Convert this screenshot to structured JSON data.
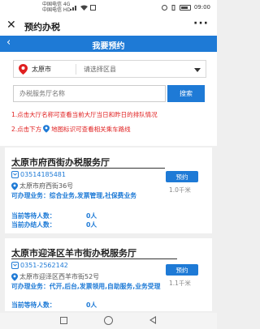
{
  "status_bar": {
    "carrier_1": "中国电信 4G",
    "carrier_2": "中国电信 HD",
    "time": "09:00"
  },
  "app_bar": {
    "close_icon": "close-icon",
    "title": "预约办税",
    "more_icon": "more-icon"
  },
  "header": {
    "back_icon": "back-icon",
    "title": "我要预约"
  },
  "filter": {
    "city": "太原市",
    "district_placeholder": "请选择区县",
    "search_placeholder": "办税服务厅名称",
    "search_button": "搜索",
    "tip1": "1.点击大厅名称可查看当前大厅当日和昨日的排队情况",
    "tip2_prefix": "2.点击下方",
    "tip2_suffix": "地图标识可查看相关乘车路线"
  },
  "halls": [
    {
      "name": "太原市府西街办税服务厅",
      "phone": "03514185481",
      "address": "太原市府西街36号",
      "business_label": "可办理业务：",
      "business": "综合业务,发票管理,社保费业务",
      "waiting_label": "当前等待人数：",
      "waiting": "0人",
      "handling_label": "当前办结人数：",
      "handling": "0人",
      "button": "预约",
      "distance": "1.0千米"
    },
    {
      "name": "太原市迎泽区羊市街办税服务厅",
      "phone": "0351-2562142",
      "address": "太原市迎泽区西羊市街52号",
      "business_label": "可办理业务：",
      "business": "代开,后台,发票领用,自助服务,业务受理",
      "waiting_label": "当前等待人数：",
      "waiting": "0人",
      "button": "预约",
      "distance": "1.1千米"
    }
  ],
  "colors": {
    "primary": "#1e7ad6",
    "tip_red": "#e02020"
  }
}
